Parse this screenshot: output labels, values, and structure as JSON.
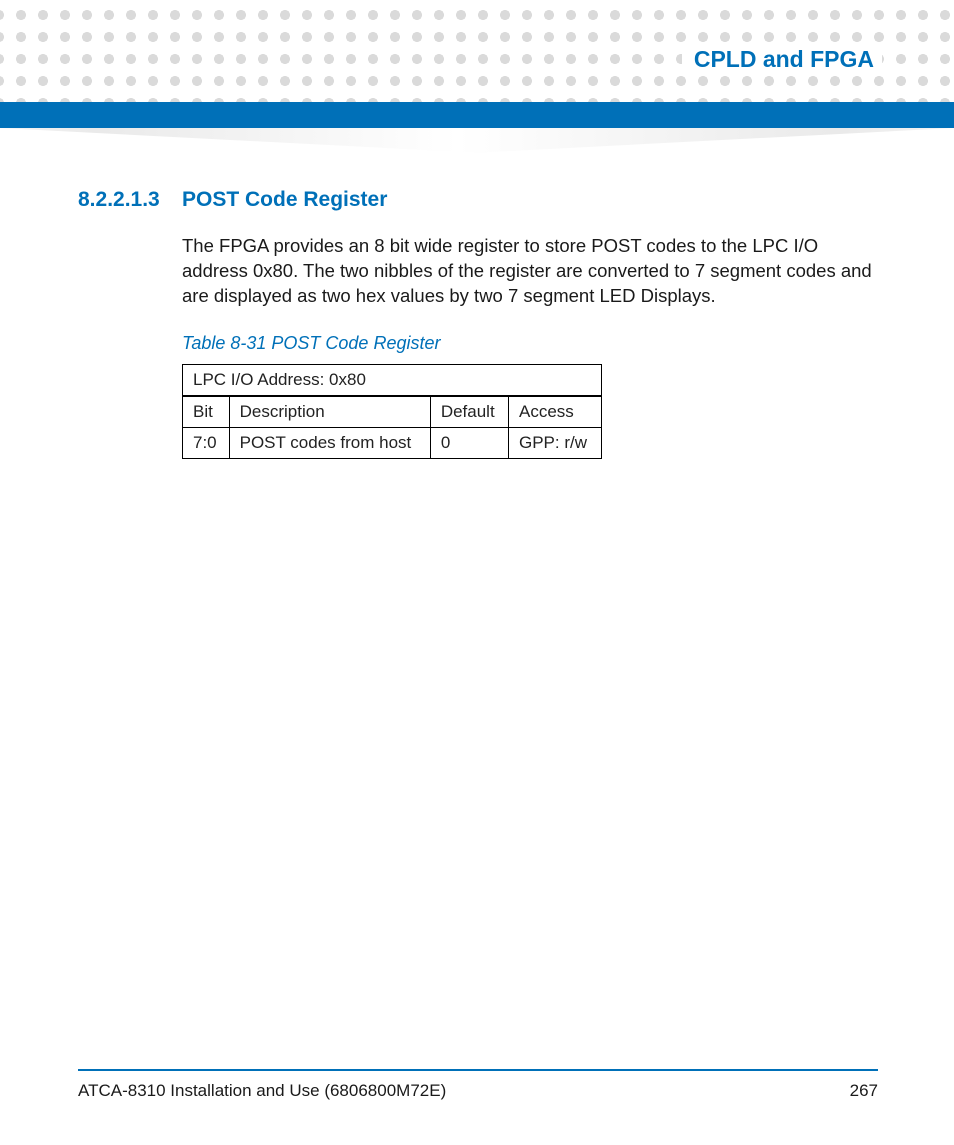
{
  "header": {
    "chapter_title": "CPLD and FPGA"
  },
  "section": {
    "number": "8.2.2.1.3",
    "title": "POST Code Register",
    "body": "The FPGA provides an 8 bit wide register to store POST codes to the LPC I/O address 0x80. The two nibbles of the register are converted to 7 segment codes and are displayed as two hex values by two 7 segment LED Displays."
  },
  "table": {
    "caption": "Table 8-31 POST Code Register",
    "address_line": "LPC I/O Address: 0x80",
    "headers": [
      "Bit",
      "Description",
      "Default",
      "Access"
    ],
    "rows": [
      [
        "7:0",
        "POST codes from host",
        "0",
        "GPP: r/w"
      ]
    ]
  },
  "footer": {
    "doc_title": "ATCA-8310 Installation and Use (6806800M72E)",
    "page": "267"
  }
}
